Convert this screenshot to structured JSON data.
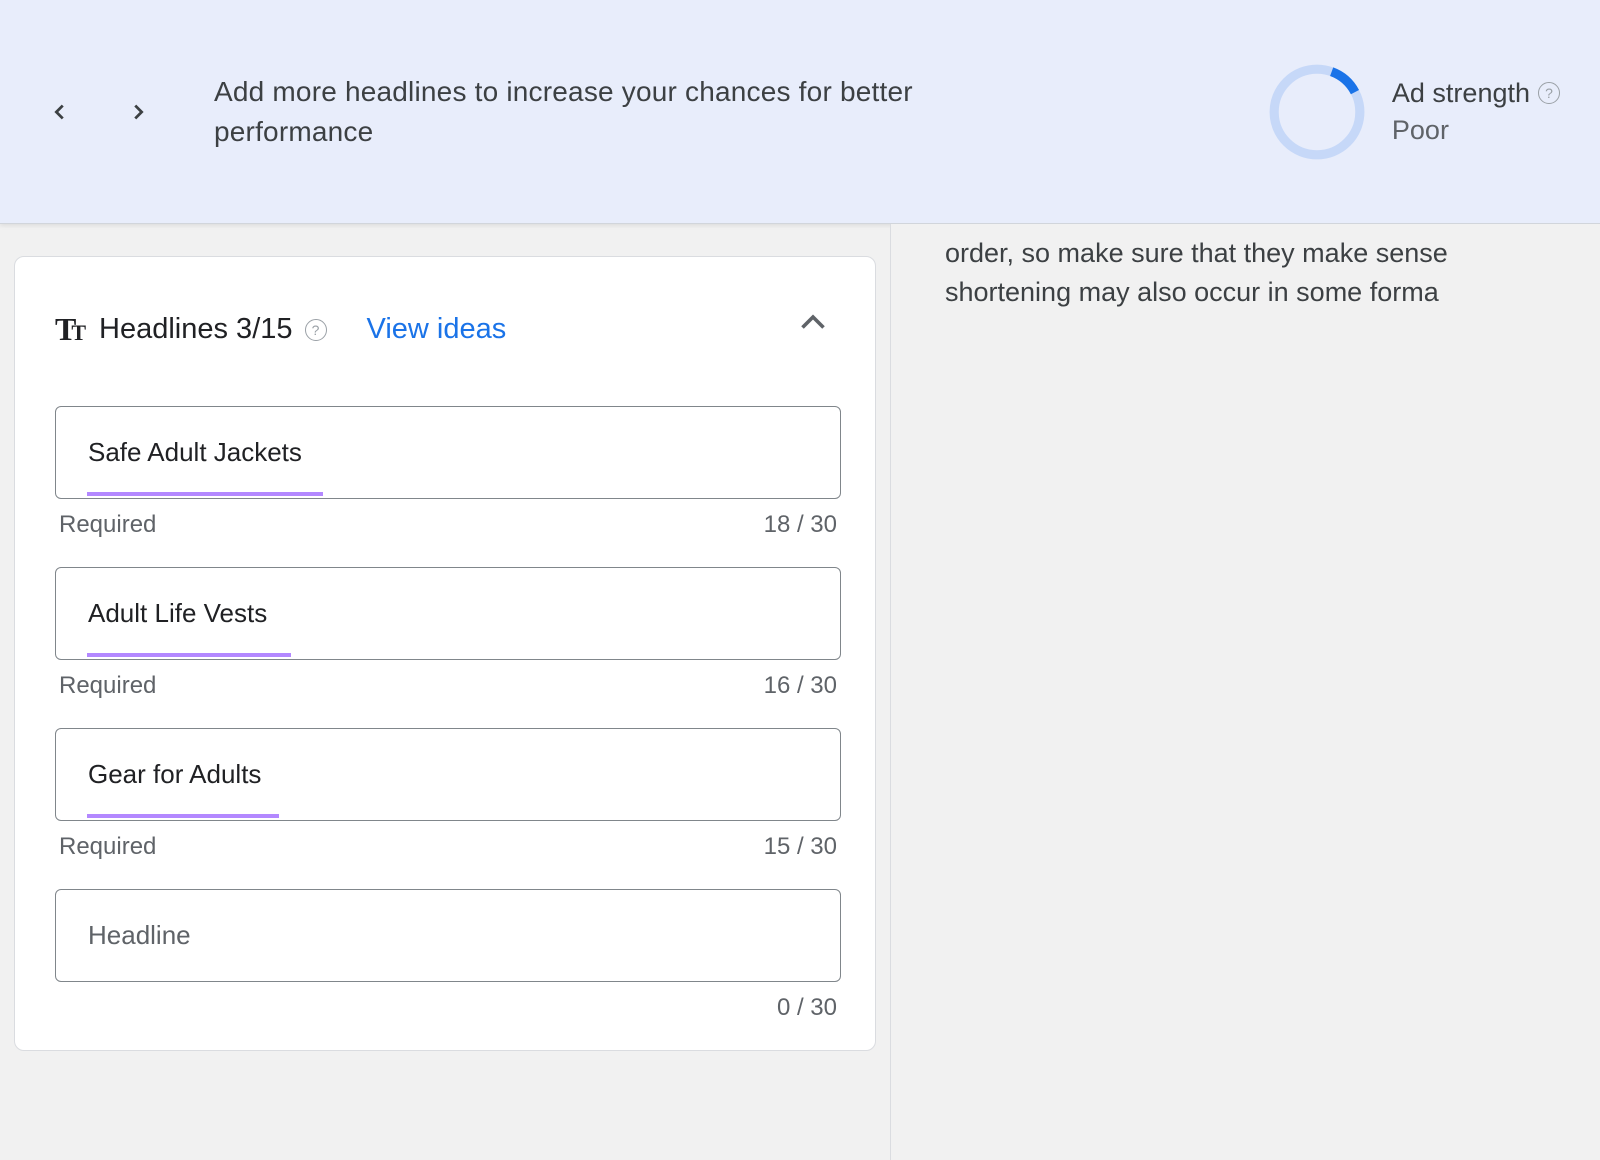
{
  "banner": {
    "message": "Add more headlines to increase your chances for better performance"
  },
  "ad_strength": {
    "label": "Ad strength",
    "value": "Poor",
    "percent": 12
  },
  "headlines_card": {
    "title": "Headlines 3/15",
    "view_ideas_label": "View ideas",
    "inputs": [
      {
        "value": "Safe Adult Jackets",
        "required_label": "Required",
        "counter": "18 / 30",
        "underline_width": 236
      },
      {
        "value": "Adult Life Vests",
        "required_label": "Required",
        "counter": "16 / 30",
        "underline_width": 204
      },
      {
        "value": "Gear for Adults",
        "required_label": "Required",
        "counter": "15 / 30",
        "underline_width": 192
      },
      {
        "value": "",
        "placeholder": "Headline",
        "required_label": "",
        "counter": "0 / 30",
        "underline_width": 0
      }
    ]
  },
  "right_panel": {
    "line1": "order, so make sure that they make sense",
    "line2": "shortening may also occur in some forma"
  }
}
